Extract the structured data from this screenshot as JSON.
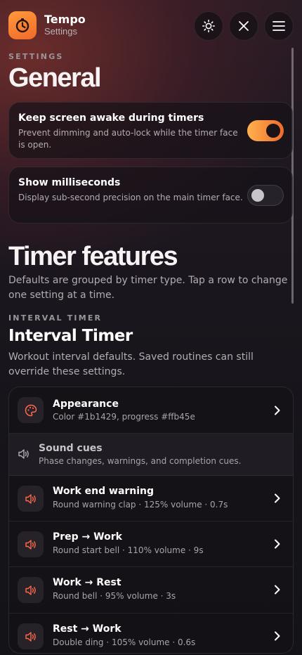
{
  "app": {
    "name": "Tempo",
    "subtitle": "Settings"
  },
  "header_buttons": [
    {
      "icon": "sun-icon"
    },
    {
      "icon": "close-icon"
    },
    {
      "icon": "menu-icon"
    }
  ],
  "general": {
    "eyebrow": "SETTINGS",
    "title": "General",
    "settings": [
      {
        "title": "Keep screen awake during timers",
        "desc": "Prevent dimming and auto-lock while the timer face is open.",
        "on": true
      },
      {
        "title": "Show milliseconds",
        "desc": "Display sub-second precision on the main timer face.",
        "on": false
      }
    ]
  },
  "timer_features": {
    "title": "Timer features",
    "desc": "Defaults are grouped by timer type. Tap a row to change one setting at a time."
  },
  "interval": {
    "eyebrow": "INTERVAL TIMER",
    "title": "Interval Timer",
    "desc": "Workout interval defaults. Saved routines can still override these settings.",
    "rows": [
      {
        "title": "Appearance",
        "sub": "Color #1b1429, progress #ffb45e",
        "icon": "palette-icon"
      },
      {
        "title": "Sound cues",
        "sub": "Phase changes, warnings, and completion cues.",
        "icon": "speaker-icon",
        "section": true
      },
      {
        "title": "Work end warning",
        "sub": "Round warning clap · 125% volume · 0.7s",
        "icon": "speaker-icon"
      },
      {
        "title": "Prep → Work",
        "sub": "Round start bell · 110% volume · 9s",
        "icon": "speaker-icon"
      },
      {
        "title": "Work → Rest",
        "sub": "Round bell · 95% volume · 3s",
        "icon": "speaker-icon"
      },
      {
        "title": "Rest → Work",
        "sub": "Double ding · 105% volume · 0.6s",
        "icon": "speaker-icon"
      }
    ]
  },
  "colors": {
    "accent": "#f58a3a",
    "accent_light": "#ffb24f",
    "icon_accent": "#ff6a4a"
  }
}
